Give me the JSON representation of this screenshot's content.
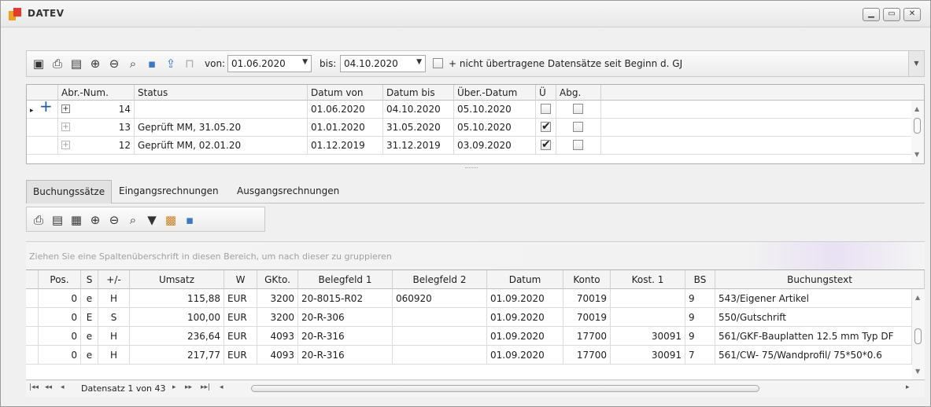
{
  "window": {
    "title": "DATEV"
  },
  "toolbar": {
    "icons": [
      "save-icon",
      "print-icon",
      "preview-icon",
      "zoom-in-icon",
      "zoom-out-icon",
      "find-icon",
      "help-icon",
      "export-icon",
      "lock-icon"
    ],
    "from_label": "von:",
    "from_value": "01.06.2020",
    "to_label": "bis:",
    "to_value": "04.10.2020",
    "include_label": "+ nicht übertragene Datensätze seit Beginn d. GJ"
  },
  "grid1": {
    "headers": [
      "Abr.-Num.",
      "Status",
      "Datum von",
      "Datum bis",
      "Über.-Datum",
      "Ü",
      "Abg."
    ],
    "rows": [
      {
        "num": "14",
        "status": "",
        "from": "01.06.2020",
        "to": "04.10.2020",
        "transfer": "05.10.2020",
        "u": false,
        "abg": false
      },
      {
        "num": "13",
        "status": "Geprüft MM, 31.05.20",
        "from": "01.01.2020",
        "to": "31.05.2020",
        "transfer": "05.10.2020",
        "u": true,
        "abg": false
      },
      {
        "num": "12",
        "status": "Geprüft MM, 02.01.20",
        "from": "01.12.2019",
        "to": "31.12.2019",
        "transfer": "03.09.2020",
        "u": true,
        "abg": false
      }
    ]
  },
  "tabs": [
    "Buchungssätze",
    "Eingangsrechnungen",
    "Ausgangsrechnungen"
  ],
  "group_hint": "Ziehen Sie eine Spaltenüberschrift in diesen Bereich, um nach dieser zu gruppieren",
  "grid2": {
    "headers": [
      "Pos.",
      "S",
      "+/-",
      "Umsatz",
      "W",
      "GKto.",
      "Belegfeld 1",
      "Belegfeld 2",
      "Datum",
      "Konto",
      "Kost. 1",
      "BS",
      "Buchungstext"
    ],
    "rows": [
      [
        "0",
        "e",
        "H",
        "115,88",
        "EUR",
        "3200",
        "20-8015-R02",
        "060920",
        "01.09.2020",
        "70019",
        "",
        "9",
        "543/Eigener Artikel"
      ],
      [
        "0",
        "E",
        "S",
        "100,00",
        "EUR",
        "3200",
        "20-R-306",
        "",
        "01.09.2020",
        "70019",
        "",
        "9",
        "550/Gutschrift"
      ],
      [
        "0",
        "e",
        "H",
        "236,64",
        "EUR",
        "4093",
        "20-R-316",
        "",
        "01.09.2020",
        "17700",
        "30091",
        "9",
        "561/GKF-Bauplatten 12.5 mm Typ DF"
      ],
      [
        "0",
        "e",
        "H",
        "217,77",
        "EUR",
        "4093",
        "20-R-316",
        "",
        "01.09.2020",
        "17700",
        "30091",
        "7",
        "561/CW- 75/Wandprofil/ 75*50*0.6"
      ]
    ]
  },
  "navigator": {
    "text": "Datensatz 1 von 43"
  }
}
